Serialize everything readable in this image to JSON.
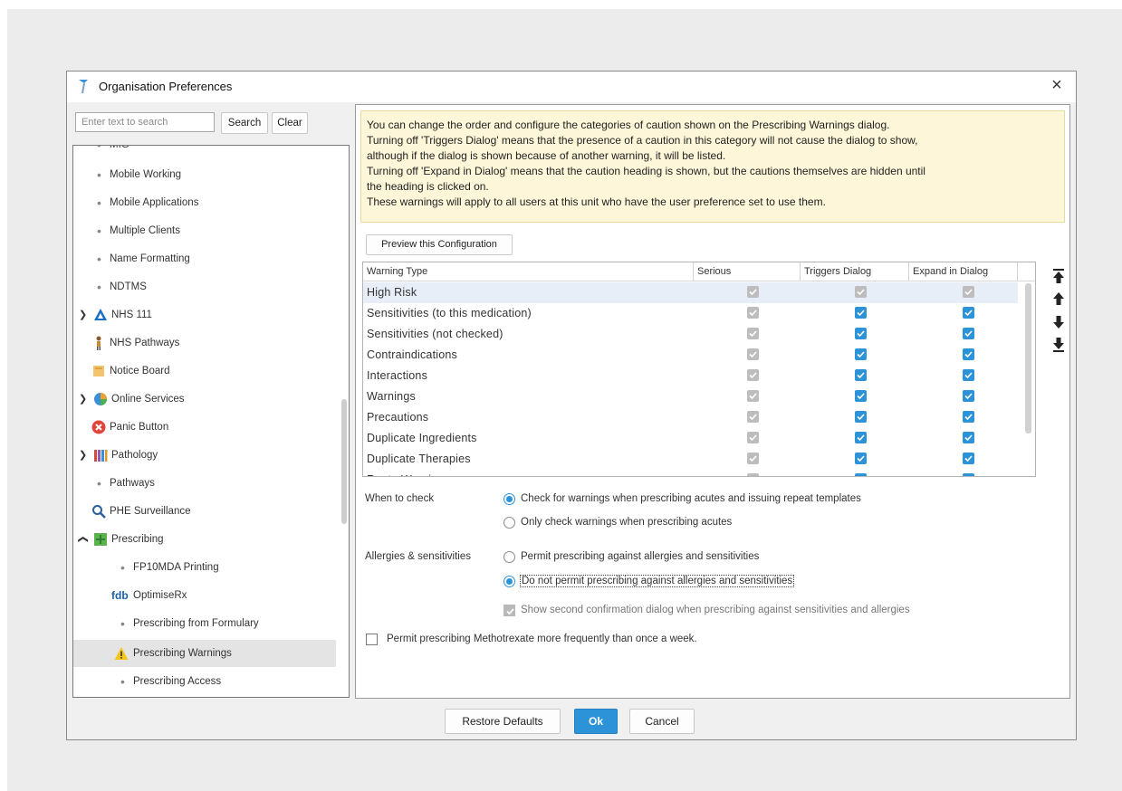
{
  "dialog": {
    "title": "Organisation Preferences",
    "close_symbol": "×"
  },
  "search": {
    "placeholder": "Enter text to search",
    "search_label": "Search",
    "clear_label": "Clear"
  },
  "tree": {
    "items": [
      {
        "label": "MIG",
        "icon": "bullet"
      },
      {
        "label": "Mobile Working",
        "icon": "bullet"
      },
      {
        "label": "Mobile Applications",
        "icon": "bullet"
      },
      {
        "label": "Multiple Clients",
        "icon": "bullet"
      },
      {
        "label": "Name Formatting",
        "icon": "bullet"
      },
      {
        "label": "NDTMS",
        "icon": "bullet"
      },
      {
        "label": "NHS 111",
        "icon": "nhs-triangle-icon",
        "expanded": true
      },
      {
        "label": "NHS Pathways",
        "icon": "pathways-figure-icon"
      },
      {
        "label": "Notice Board",
        "icon": "notice-board-icon"
      },
      {
        "label": "Online Services",
        "icon": "online-services-icon",
        "expanded": true
      },
      {
        "label": "Panic Button",
        "icon": "panic-button-icon"
      },
      {
        "label": "Pathology",
        "icon": "pathology-tubes-icon",
        "expanded": true
      },
      {
        "label": "Pathways",
        "icon": "bullet"
      },
      {
        "label": "PHE Surveillance",
        "icon": "magnifier-icon"
      },
      {
        "label": "Prescribing",
        "icon": "prescribing-icon",
        "expanded": false
      },
      {
        "label": "FP10MDA Printing",
        "icon": "bullet"
      },
      {
        "label": "OptimiseRx",
        "icon": "fdb-icon",
        "icon_text": "fdb"
      },
      {
        "label": "Prescribing from Formulary",
        "icon": "bullet"
      },
      {
        "label": "Prescribing Warnings",
        "icon": "warning-icon",
        "selected": true
      },
      {
        "label": "Prescribing Access",
        "icon": "bullet"
      }
    ]
  },
  "info": {
    "lines": [
      "You can change the order and configure the categories of caution shown on the Prescribing Warnings dialog.",
      "Turning off 'Triggers Dialog' means that the presence of a caution in this category will not cause the dialog to show,",
      "although if the dialog is shown because of another warning, it will be listed.",
      "Turning off 'Expand in Dialog' means that the caution heading is shown, but the cautions themselves are hidden until",
      "the heading is clicked on.",
      "These warnings will apply to all users at this unit who have the user preference set to use them."
    ]
  },
  "preview_label": "Preview this Configuration",
  "warnings_table": {
    "headers": [
      "Warning Type",
      "Serious",
      "Triggers Dialog",
      "Expand in Dialog"
    ],
    "rows": [
      {
        "type": "High Risk",
        "serious": "checked-disabled",
        "triggers": "checked-disabled",
        "expand": "checked-disabled"
      },
      {
        "type": "Sensitivities (to this medication)",
        "serious": "checked-disabled",
        "triggers": "checked",
        "expand": "checked"
      },
      {
        "type": "Sensitivities (not checked)",
        "serious": "checked-disabled",
        "triggers": "checked",
        "expand": "checked"
      },
      {
        "type": "Contraindications",
        "serious": "checked-disabled",
        "triggers": "checked",
        "expand": "checked"
      },
      {
        "type": "Interactions",
        "serious": "checked-disabled",
        "triggers": "checked",
        "expand": "checked"
      },
      {
        "type": "Warnings",
        "serious": "checked-disabled",
        "triggers": "checked",
        "expand": "checked"
      },
      {
        "type": "Precautions",
        "serious": "checked-disabled",
        "triggers": "checked",
        "expand": "checked"
      },
      {
        "type": "Duplicate Ingredients",
        "serious": "checked-disabled",
        "triggers": "checked",
        "expand": "checked"
      },
      {
        "type": "Duplicate Therapies",
        "serious": "checked-disabled",
        "triggers": "checked",
        "expand": "checked"
      },
      {
        "type": "Route Warnings",
        "serious": "checked-disabled",
        "triggers": "checked",
        "expand": "checked"
      }
    ]
  },
  "order_buttons": [
    "move-top-icon",
    "move-up-icon",
    "move-down-icon",
    "move-bottom-icon"
  ],
  "when_to_check": {
    "label": "When to check",
    "options": [
      {
        "text": "Check for warnings when prescribing acutes and issuing repeat templates",
        "selected": true
      },
      {
        "text": "Only check warnings when prescribing acutes",
        "selected": false
      }
    ]
  },
  "allergies": {
    "label": "Allergies & sensitivities",
    "options": [
      {
        "text": "Permit prescribing against allergies and sensitivities",
        "selected": false
      },
      {
        "text": "Do not permit prescribing against allergies and sensitivities",
        "selected": true
      }
    ],
    "confirm_text": "Show second confirmation dialog when prescribing against sensitivities and allergies",
    "confirm_checked": true
  },
  "methotrexate": {
    "text": "Permit prescribing Methotrexate more frequently than once a week.",
    "checked": false
  },
  "footer": {
    "restore_label": "Restore Defaults",
    "ok_label": "Ok",
    "cancel_label": "Cancel"
  },
  "colors": {
    "accent": "#2d93d9",
    "info_background": "#fdf6d8",
    "selection": "#e4e4e4"
  }
}
